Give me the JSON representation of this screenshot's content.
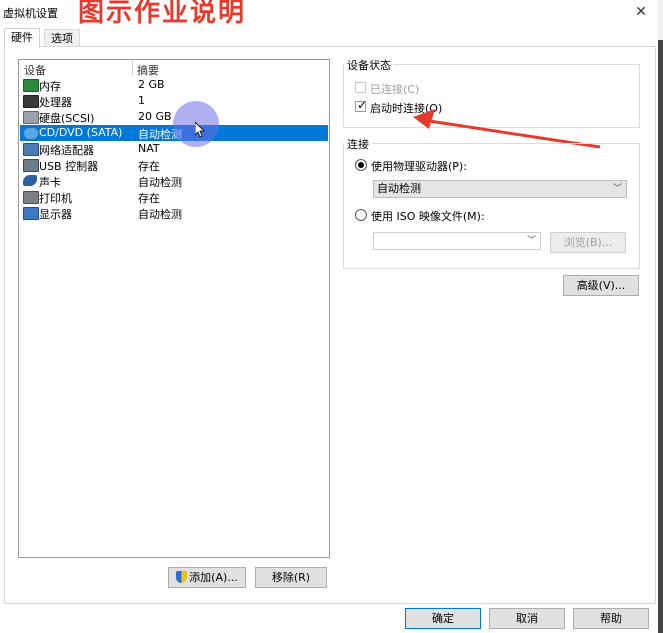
{
  "window": {
    "title": "虚拟机设置",
    "overlay_caption": "图示作业说明",
    "close_symbol": "✕"
  },
  "tabs": [
    {
      "label": "硬件",
      "active": true
    },
    {
      "label": "选项",
      "active": false
    }
  ],
  "device_list": {
    "headers": {
      "device": "设备",
      "summary": "摘要"
    },
    "rows": [
      {
        "device": "内存",
        "summary": "2 GB",
        "icon": "memory-icon"
      },
      {
        "device": "处理器",
        "summary": "1",
        "icon": "processor-icon"
      },
      {
        "device": "硬盘(SCSI)",
        "summary": "20 GB",
        "icon": "hard-disk-icon"
      },
      {
        "device": "CD/DVD (SATA)",
        "summary": "自动检测",
        "icon": "cd-dvd-icon",
        "selected": true
      },
      {
        "device": "网络适配器",
        "summary": "NAT",
        "icon": "network-adapter-icon"
      },
      {
        "device": "USB 控制器",
        "summary": "存在",
        "icon": "usb-icon"
      },
      {
        "device": "声卡",
        "summary": "自动检测",
        "icon": "sound-card-icon"
      },
      {
        "device": "打印机",
        "summary": "存在",
        "icon": "printer-icon"
      },
      {
        "device": "显示器",
        "summary": "自动检测",
        "icon": "display-icon"
      }
    ]
  },
  "list_buttons": {
    "add": "添加(A)...",
    "remove": "移除(R)"
  },
  "device_status": {
    "title": "设备状态",
    "connected": {
      "label": "已连接(C)",
      "checked": false,
      "disabled": true
    },
    "connect_at_power_on": {
      "label": "启动时连接(O)",
      "checked": true
    }
  },
  "connection": {
    "title": "连接",
    "physical_drive": {
      "label": "使用物理驱动器(P):",
      "selected": true,
      "value": "自动检测"
    },
    "iso_image": {
      "label": "使用 ISO 映像文件(M):",
      "selected": false,
      "value": "",
      "browse": "浏览(B)..."
    }
  },
  "advanced_button": "高级(V)...",
  "footer": {
    "ok": "确定",
    "cancel": "取消",
    "help": "帮助"
  },
  "colors": {
    "selection": "#0078d7",
    "annotation_red": "#e53b2f",
    "cursor_highlight": "#6e6ee6"
  }
}
